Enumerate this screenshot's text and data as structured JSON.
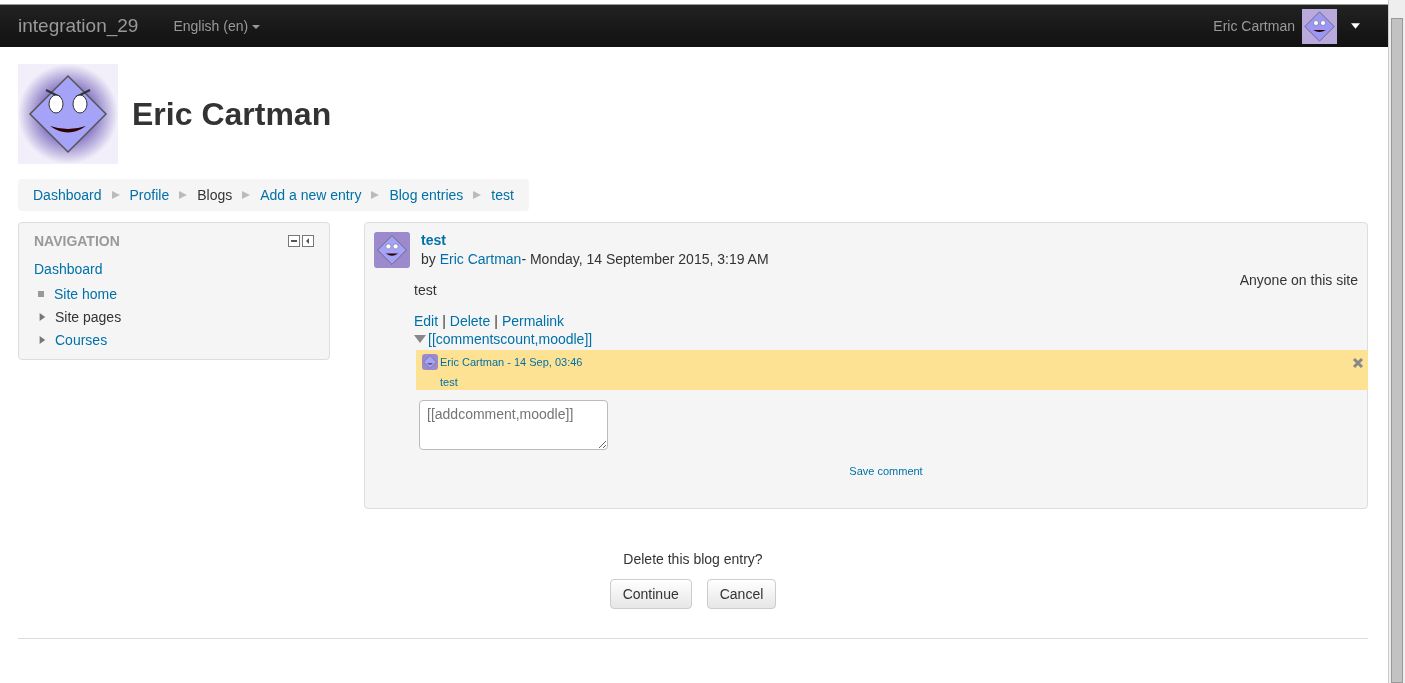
{
  "navbar": {
    "brand": "integration_29",
    "language": "English (en)",
    "user_name": "Eric Cartman"
  },
  "page_header": {
    "title": "Eric Cartman"
  },
  "breadcrumb": [
    {
      "label": "Dashboard",
      "link": true
    },
    {
      "label": "Profile",
      "link": true
    },
    {
      "label": "Blogs",
      "link": false
    },
    {
      "label": "Add a new entry",
      "link": true
    },
    {
      "label": "Blog entries",
      "link": true
    },
    {
      "label": "test",
      "link": true
    }
  ],
  "navigation": {
    "title": "NAVIGATION",
    "top": "Dashboard",
    "items": [
      {
        "label": "Site home",
        "kind": "leaf",
        "link": true
      },
      {
        "label": "Site pages",
        "kind": "branch",
        "link": false,
        "expanded": false
      },
      {
        "label": "Courses",
        "kind": "branch",
        "link": true,
        "expanded": false
      }
    ]
  },
  "blog_entry": {
    "title": "test",
    "by": "by",
    "author": "Eric Cartman",
    "date": " - Monday, 14 September 2015, 3:19 AM",
    "visibility": "Anyone on this site",
    "body": "test",
    "actions": [
      "Edit",
      "Delete",
      "Permalink"
    ],
    "action_separator": "|",
    "comments": {
      "toggle": "[[commentscount,moodle]]",
      "expanded": true,
      "items": [
        {
          "header": "Eric Cartman - 14 Sep, 03:46",
          "text": "test"
        }
      ],
      "placeholder": "[[addcomment,moodle]]",
      "save": "Save comment"
    }
  },
  "confirm": {
    "question": "Delete this blog entry?",
    "buttons": [
      "Continue",
      "Cancel"
    ]
  }
}
